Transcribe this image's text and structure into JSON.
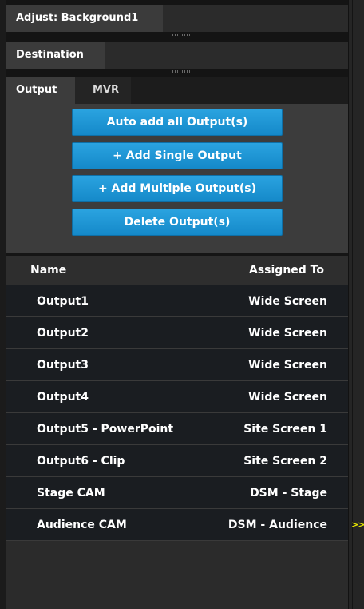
{
  "panel": {
    "adjust_title": "Adjust: Background1",
    "destination_title": "Destination"
  },
  "tabs": [
    {
      "label": "Output",
      "active": true
    },
    {
      "label": "MVR",
      "active": false
    }
  ],
  "buttons": {
    "auto_add": "Auto add all Output(s)",
    "add_single": "+ Add Single Output",
    "add_multiple": "+ Add Multiple Output(s)",
    "delete": "Delete Output(s)"
  },
  "table": {
    "headers": {
      "name": "Name",
      "assigned_to": "Assigned To"
    },
    "rows": [
      {
        "name": "Output1",
        "assigned": "Wide Screen"
      },
      {
        "name": "Output2",
        "assigned": "Wide Screen"
      },
      {
        "name": "Output3",
        "assigned": "Wide Screen"
      },
      {
        "name": "Output4",
        "assigned": "Wide Screen"
      },
      {
        "name": "Output5 - PowerPoint",
        "assigned": "Site Screen 1"
      },
      {
        "name": "Output6 - Clip",
        "assigned": "Site Screen 2"
      },
      {
        "name": "Stage CAM",
        "assigned": "DSM - Stage"
      },
      {
        "name": "Audience CAM",
        "assigned": "DSM - Audience"
      }
    ]
  },
  "side": {
    "expand_glyph": ">>"
  },
  "colors": {
    "button": "#1a92d4",
    "chevron": "#e6e600"
  }
}
